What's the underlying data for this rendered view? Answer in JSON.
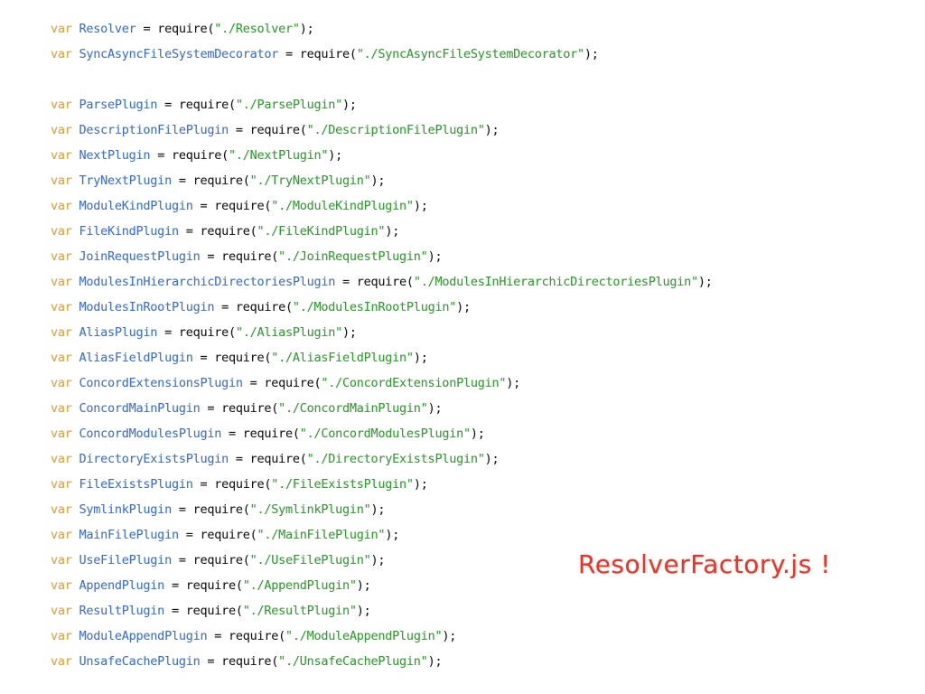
{
  "code": {
    "keyword": "var",
    "assign": " = ",
    "call": "require(",
    "close": ");",
    "groups": [
      [
        {
          "name": "Resolver",
          "path": "\"./Resolver\""
        },
        {
          "name": "SyncAsyncFileSystemDecorator",
          "path": "\"./SyncAsyncFileSystemDecorator\""
        }
      ],
      [
        {
          "name": "ParsePlugin",
          "path": "\"./ParsePlugin\""
        },
        {
          "name": "DescriptionFilePlugin",
          "path": "\"./DescriptionFilePlugin\""
        },
        {
          "name": "NextPlugin",
          "path": "\"./NextPlugin\""
        },
        {
          "name": "TryNextPlugin",
          "path": "\"./TryNextPlugin\""
        },
        {
          "name": "ModuleKindPlugin",
          "path": "\"./ModuleKindPlugin\""
        },
        {
          "name": "FileKindPlugin",
          "path": "\"./FileKindPlugin\""
        },
        {
          "name": "JoinRequestPlugin",
          "path": "\"./JoinRequestPlugin\""
        },
        {
          "name": "ModulesInHierarchicDirectoriesPlugin",
          "path": "\"./ModulesInHierarchicDirectoriesPlugin\""
        },
        {
          "name": "ModulesInRootPlugin",
          "path": "\"./ModulesInRootPlugin\""
        },
        {
          "name": "AliasPlugin",
          "path": "\"./AliasPlugin\""
        },
        {
          "name": "AliasFieldPlugin",
          "path": "\"./AliasFieldPlugin\""
        },
        {
          "name": "ConcordExtensionsPlugin",
          "path": "\"./ConcordExtensionPlugin\""
        },
        {
          "name": "ConcordMainPlugin",
          "path": "\"./ConcordMainPlugin\""
        },
        {
          "name": "ConcordModulesPlugin",
          "path": "\"./ConcordModulesPlugin\""
        },
        {
          "name": "DirectoryExistsPlugin",
          "path": "\"./DirectoryExistsPlugin\""
        },
        {
          "name": "FileExistsPlugin",
          "path": "\"./FileExistsPlugin\""
        },
        {
          "name": "SymlinkPlugin",
          "path": "\"./SymlinkPlugin\""
        },
        {
          "name": "MainFilePlugin",
          "path": "\"./MainFilePlugin\""
        },
        {
          "name": "UseFilePlugin",
          "path": "\"./UseFilePlugin\""
        },
        {
          "name": "AppendPlugin",
          "path": "\"./AppendPlugin\""
        },
        {
          "name": "ResultPlugin",
          "path": "\"./ResultPlugin\""
        },
        {
          "name": "ModuleAppendPlugin",
          "path": "\"./ModuleAppendPlugin\""
        },
        {
          "name": "UnsafeCachePlugin",
          "path": "\"./UnsafeCachePlugin\""
        }
      ]
    ]
  },
  "annotation": {
    "text": "ResolverFactory.js !"
  },
  "colors": {
    "keyword": "#e3a33b",
    "identifier": "#3b6fd6",
    "string": "#2d9e2d",
    "punctuation": "#111111",
    "annotation": "#e0382b",
    "background": "#ffffff"
  }
}
